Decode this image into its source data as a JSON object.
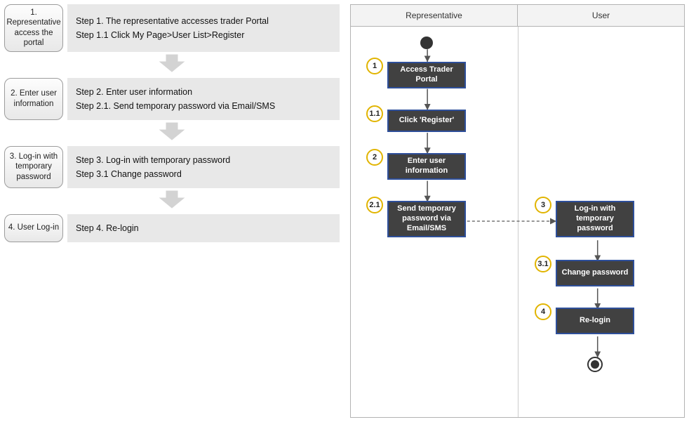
{
  "steps": [
    {
      "tag": "1. Representative access the portal",
      "lines": [
        "Step 1. The representative accesses trader Portal",
        "Step 1.1 Click My Page>User List>Register"
      ]
    },
    {
      "tag": "2. Enter user information",
      "lines": [
        "Step 2. Enter user information",
        "Step 2.1. Send temporary password via Email/SMS"
      ]
    },
    {
      "tag": "3. Log-in with temporary password",
      "lines": [
        "Step 3. Log-in with temporary password",
        "Step 3.1 Change password"
      ]
    },
    {
      "tag": "4. User Log-in",
      "lines": [
        "Step 4. Re-login"
      ]
    }
  ],
  "swimlane": {
    "lanes": [
      "Representative",
      "User"
    ],
    "activities": [
      {
        "id": "A1",
        "lane": 0,
        "label": "Access Trader Portal",
        "badge": "1"
      },
      {
        "id": "A11",
        "lane": 0,
        "label": "Click 'Register'",
        "badge": "1.1"
      },
      {
        "id": "A2",
        "lane": 0,
        "label": "Enter user information",
        "badge": "2"
      },
      {
        "id": "A21",
        "lane": 0,
        "label": "Send temporary password via Email/SMS",
        "badge": "2.1"
      },
      {
        "id": "B3",
        "lane": 1,
        "label": "Log-in with temporary password",
        "badge": "3"
      },
      {
        "id": "B31",
        "lane": 1,
        "label": "Change password",
        "badge": "3.1"
      },
      {
        "id": "B4",
        "lane": 1,
        "label": "Re-login",
        "badge": "4"
      }
    ]
  }
}
